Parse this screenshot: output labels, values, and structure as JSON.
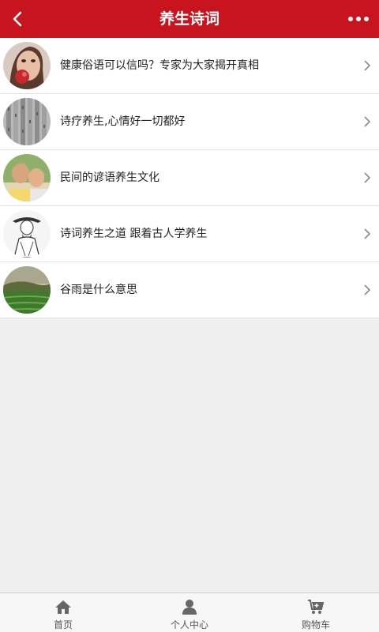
{
  "header": {
    "title": "养生诗词",
    "back_icon": "chevron-left-icon",
    "more_icon": "more-horizontal-icon",
    "background_color": "#c8141f"
  },
  "articles": [
    {
      "title": "健康俗语可以信吗？专家为大家揭开真相",
      "thumbnail": "woman-eating-apple-photo"
    },
    {
      "title": "诗疗养生,心情好一切都好",
      "thumbnail": "bamboo-scroll-photo"
    },
    {
      "title": "民间的谚语养生文化",
      "thumbnail": "elderly-couple-photo"
    },
    {
      "title": "诗词养生之道 跟着古人学养生",
      "thumbnail": "ancient-scholar-sketch"
    },
    {
      "title": "谷雨是什么意思",
      "thumbnail": "tea-field-landscape-photo"
    }
  ],
  "tabbar": {
    "home": {
      "label": "首页",
      "icon": "home-icon"
    },
    "profile": {
      "label": "个人中心",
      "icon": "user-icon"
    },
    "cart": {
      "label": "购物车",
      "icon": "shopping-cart-icon"
    }
  }
}
